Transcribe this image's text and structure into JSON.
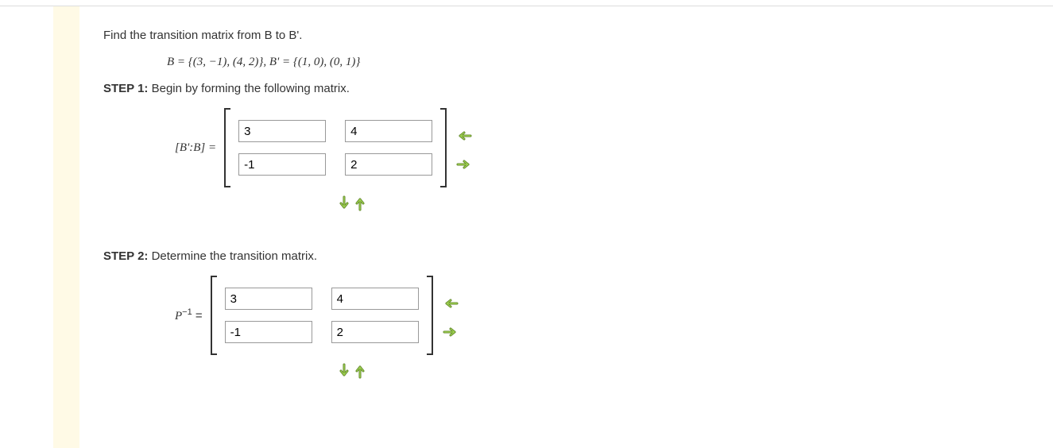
{
  "intro": "Find the transition matrix from B to B'.",
  "equation": "B = {(3, −1), (4, 2)}, B' = {(1, 0), (0, 1)}",
  "step1": {
    "label": "STEP 1:",
    "text": "Begin by forming the following matrix."
  },
  "matrix1": {
    "lhs": "[B':B] =",
    "cells": {
      "r1c1": "3",
      "r1c2": "4",
      "r2c1": "-1",
      "r2c2": "2"
    }
  },
  "step2": {
    "label": "STEP 2:",
    "text": "Determine the transition matrix."
  },
  "matrix2": {
    "lhs_var": "P",
    "lhs_exp": "−1",
    "lhs_eq": " =",
    "cells": {
      "r1c1": "3",
      "r1c2": "4",
      "r2c1": "-1",
      "r2c2": "2"
    }
  },
  "colors": {
    "arrow": "#7aa53c",
    "arrow_stroke": "#5c8226"
  }
}
